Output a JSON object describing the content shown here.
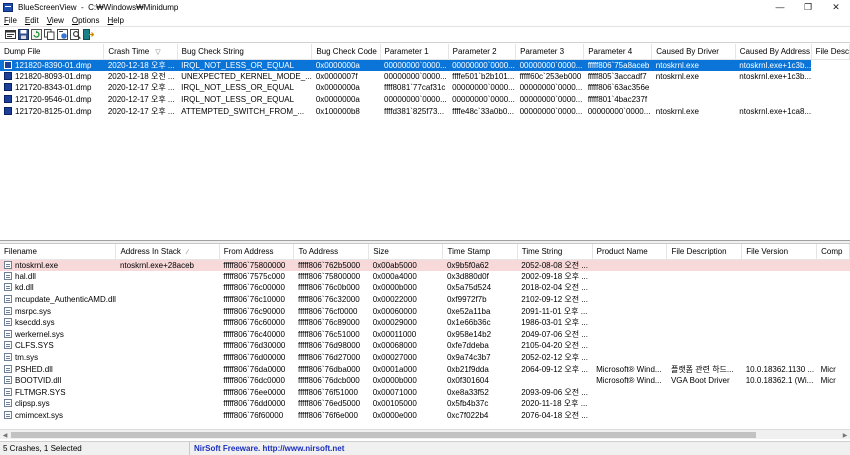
{
  "window": {
    "title": "BlueScreenView  -  C:₩Windows₩Minidump",
    "controls": {
      "minimize": "—",
      "maximize": "❐",
      "close": "✕"
    }
  },
  "menu": [
    "File",
    "Edit",
    "View",
    "Options",
    "Help"
  ],
  "toolbar": [
    {
      "icon": "properties-icon"
    },
    {
      "icon": "save-icon"
    },
    {
      "icon": "refresh-icon"
    },
    {
      "icon": "copy-icon"
    },
    {
      "icon": "html-report-icon"
    },
    {
      "icon": "find-icon"
    },
    {
      "icon": "exit-icon"
    }
  ],
  "crash_table": {
    "columns": [
      "Dump File",
      "Crash Time",
      "Bug Check String",
      "Bug Check Code",
      "Parameter 1",
      "Parameter 2",
      "Parameter 3",
      "Parameter 4",
      "Caused By Driver",
      "Caused By Address",
      "File Desc"
    ],
    "sort_column": 1,
    "sort_glyph": "▽",
    "rows": [
      [
        "121820-8390-01.dmp",
        "2020-12-18 오후 ...",
        "IRQL_NOT_LESS_OR_EQUAL",
        "0x0000000a",
        "00000000`0000...",
        "00000000`0000...",
        "00000000`0000...",
        "fffff806`75a8aceb",
        "ntoskrnl.exe",
        "ntoskrnl.exe+1c3b..."
      ],
      [
        "121820-8093-01.dmp",
        "2020-12-18 오전 ...",
        "UNEXPECTED_KERNEL_MODE_...",
        "0x0000007f",
        "00000000`0000...",
        "ffffe501`b2b101...",
        "fffff60c`253eb000",
        "fffff805`3accadf7",
        "ntoskrnl.exe",
        "ntoskrnl.exe+1c3b..."
      ],
      [
        "121720-8343-01.dmp",
        "2020-12-17 오후 ...",
        "IRQL_NOT_LESS_OR_EQUAL",
        "0x0000000a",
        "ffff8081`77caf31c",
        "00000000`0000...",
        "00000000`0000...",
        "fffff806`63ac356e",
        "",
        ""
      ],
      [
        "121720-9546-01.dmp",
        "2020-12-17 오후 ...",
        "IRQL_NOT_LESS_OR_EQUAL",
        "0x0000000a",
        "00000000`0000...",
        "00000000`0000...",
        "00000000`0000...",
        "fffff801`4bac237f",
        "",
        ""
      ],
      [
        "121720-8125-01.dmp",
        "2020-12-17 오후 ...",
        "ATTEMPTED_SWITCH_FROM_...",
        "0x100000b8",
        "ffffd381`825f73...",
        "ffffe48c`33a0b0...",
        "00000000`0000...",
        "00000000`0000...",
        "ntoskrnl.exe",
        "ntoskrnl.exe+1ca8..."
      ]
    ],
    "selected_row": 0
  },
  "driver_table": {
    "columns": [
      "Filename",
      "Address In Stack",
      "From Address",
      "To Address",
      "Size",
      "Time Stamp",
      "Time String",
      "Product Name",
      "File Description",
      "File Version",
      "Comp"
    ],
    "sort_column": 1,
    "sort_glyph": "∕",
    "rows": [
      [
        "ntoskrnl.exe",
        "ntoskrnl.exe+28aceb",
        "fffff806`75800000",
        "fffff806`762b5000",
        "0x00ab5000",
        "0x9b5f0a62",
        "2052-08-08 오전 ...",
        "",
        "",
        "",
        ""
      ],
      [
        "hal.dll",
        "",
        "fffff806`7575c000",
        "fffff806`75800000",
        "0x000a4000",
        "0x3d880d0f",
        "2002-09-18 오후 ...",
        "",
        "",
        "",
        ""
      ],
      [
        "kd.dll",
        "",
        "fffff806`76c00000",
        "fffff806`76c0b000",
        "0x0000b000",
        "0x5a75d524",
        "2018-02-04 오전 ...",
        "",
        "",
        "",
        ""
      ],
      [
        "mcupdate_AuthenticAMD.dll",
        "",
        "fffff806`76c10000",
        "fffff806`76c32000",
        "0x00022000",
        "0xf9972f7b",
        "2102-09-12 오전 ...",
        "",
        "",
        "",
        ""
      ],
      [
        "msrpc.sys",
        "",
        "fffff806`76c90000",
        "fffff806`76cf0000",
        "0x00060000",
        "0xe52a11ba",
        "2091-11-01 오후 ...",
        "",
        "",
        "",
        ""
      ],
      [
        "ksecdd.sys",
        "",
        "fffff806`76c60000",
        "fffff806`76c89000",
        "0x00029000",
        "0x1e66b36c",
        "1986-03-01 오후 ...",
        "",
        "",
        "",
        ""
      ],
      [
        "werkernel.sys",
        "",
        "fffff806`76c40000",
        "fffff806`76c51000",
        "0x00011000",
        "0x958e14b2",
        "2049-07-06 오전 ...",
        "",
        "",
        "",
        ""
      ],
      [
        "CLFS.SYS",
        "",
        "fffff806`76d30000",
        "fffff806`76d98000",
        "0x00068000",
        "0xfe7ddeba",
        "2105-04-20 오전 ...",
        "",
        "",
        "",
        ""
      ],
      [
        "tm.sys",
        "",
        "fffff806`76d00000",
        "fffff806`76d27000",
        "0x00027000",
        "0x9a74c3b7",
        "2052-02-12 오후 ...",
        "",
        "",
        "",
        ""
      ],
      [
        "PSHED.dll",
        "",
        "fffff806`76da0000",
        "fffff806`76dba000",
        "0x0001a000",
        "0xb21f9dda",
        "2064-09-12 오후 ...",
        "Microsoft® Wind...",
        "플랫폼 관련 하드...",
        "10.0.18362.1130 ...",
        "Micr"
      ],
      [
        "BOOTVID.dll",
        "",
        "fffff806`76dc0000",
        "fffff806`76dcb000",
        "0x0000b000",
        "0x0f301604",
        "",
        "Microsoft® Wind...",
        "VGA Boot Driver",
        "10.0.18362.1 (Wi...",
        "Micr"
      ],
      [
        "FLTMGR.SYS",
        "",
        "fffff806`76ee0000",
        "fffff806`76f51000",
        "0x00071000",
        "0xe8a33f52",
        "2093-09-06 오전 ...",
        "",
        "",
        "",
        ""
      ],
      [
        "clipsp.sys",
        "",
        "fffff806`76dd0000",
        "fffff806`76ed5000",
        "0x00105000",
        "0x5fb4b37c",
        "2020-11-18 오후 ...",
        "",
        "",
        "",
        ""
      ],
      [
        "cmimcext.sys",
        "",
        "fffff806`76f60000",
        "fffff806`76f6e000",
        "0x0000e000",
        "0xc7f022b4",
        "2076-04-18 오전 ...",
        "",
        "",
        "",
        ""
      ]
    ],
    "highlighted_row": 0
  },
  "status": {
    "left": "5 Crashes, 1 Selected",
    "right": "NirSoft Freeware.  http://www.nirsoft.net"
  },
  "colors": {
    "selection": "#0a74d8",
    "highlight_row": "#f7d9d9",
    "link": "#1a2fc0"
  }
}
